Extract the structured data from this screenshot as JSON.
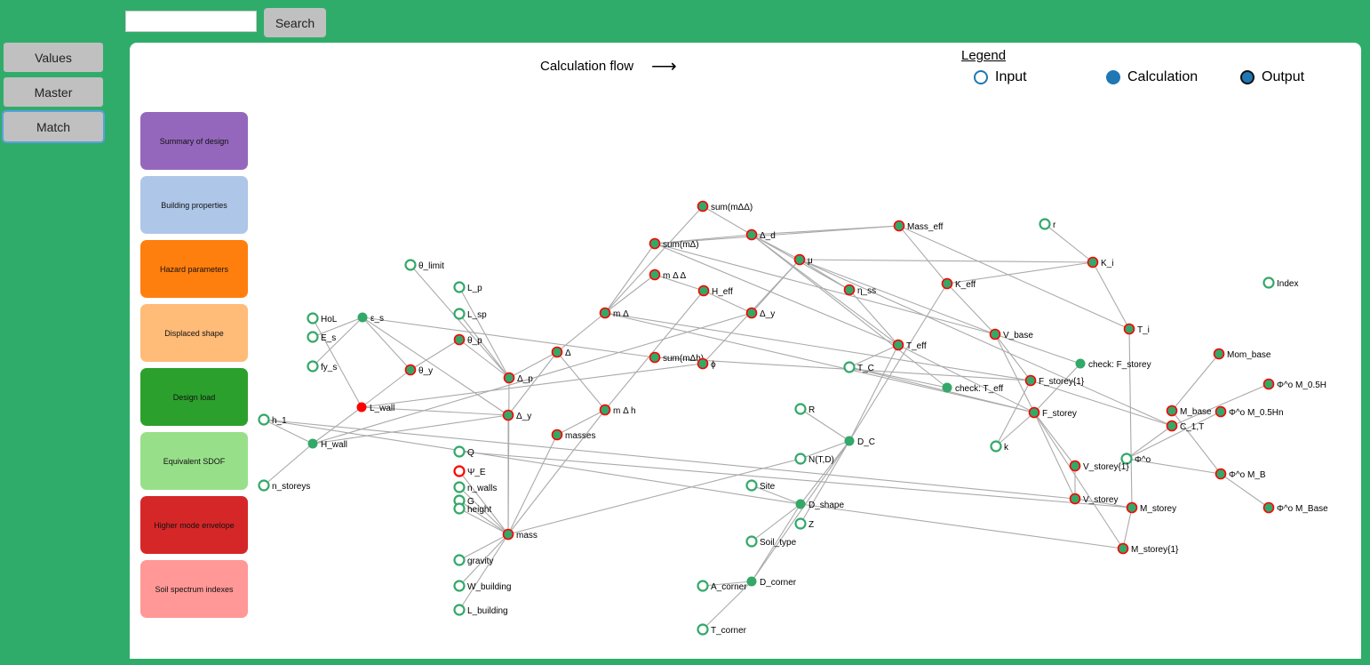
{
  "search": {
    "value": "",
    "button_label": "Search"
  },
  "sidebar": {
    "buttons": [
      {
        "label": "Values"
      },
      {
        "label": "Master"
      },
      {
        "label": "Match",
        "active": true
      }
    ]
  },
  "graph_title": "Calculation flow",
  "legend": {
    "title": "Legend",
    "items": [
      {
        "label": "Input",
        "kind": "input"
      },
      {
        "label": "Calculation",
        "kind": "calculation"
      },
      {
        "label": "Output",
        "kind": "output"
      }
    ],
    "color": "#1f77b4"
  },
  "categories": [
    {
      "label": "Summary of design",
      "color": "#9467bd"
    },
    {
      "label": "Building properties",
      "color": "#aec7e8"
    },
    {
      "label": "Hazard parameters",
      "color": "#ff7f0e"
    },
    {
      "label": "Displaced shape",
      "color": "#ffbb78"
    },
    {
      "label": "Design load",
      "color": "#2ca02c"
    },
    {
      "label": "Equivalent SDOF",
      "color": "#98df8a"
    },
    {
      "label": "Higher mode envelope",
      "color": "#d62728"
    },
    {
      "label": "Soil spectrum indexes",
      "color": "#ff9896"
    }
  ],
  "colors": {
    "background": "#30ac6a",
    "node": "#33a868",
    "highlight": "#ff0000",
    "edge": "#aaaaaa"
  },
  "nodes": [
    {
      "id": "sum_mdd",
      "label": "sum(mΔΔ)",
      "type": "output"
    },
    {
      "id": "sum_md",
      "label": "sum(mΔ)",
      "type": "output"
    },
    {
      "id": "d_d",
      "label": "Δ_d",
      "type": "output"
    },
    {
      "id": "mass_eff",
      "label": "Mass_eff",
      "type": "output"
    },
    {
      "id": "r",
      "label": "r",
      "type": "input"
    },
    {
      "id": "mu",
      "label": "μ",
      "type": "output"
    },
    {
      "id": "K_i",
      "label": "K_i",
      "type": "output"
    },
    {
      "id": "theta_limit",
      "label": "θ_limit",
      "type": "input"
    },
    {
      "id": "L_p",
      "label": "L_p",
      "type": "input"
    },
    {
      "id": "m_dd",
      "label": "m Δ Δ",
      "type": "output"
    },
    {
      "id": "H_eff",
      "label": "H_eff",
      "type": "output"
    },
    {
      "id": "eta_ss",
      "label": "η_ss",
      "type": "output"
    },
    {
      "id": "K_eff",
      "label": "K_eff",
      "type": "output"
    },
    {
      "id": "Index",
      "label": "Index",
      "type": "input"
    },
    {
      "id": "L_sp",
      "label": "L_sp",
      "type": "input"
    },
    {
      "id": "HoL",
      "label": "HoL",
      "type": "input"
    },
    {
      "id": "eps_s",
      "label": "ε_s",
      "type": "calculation"
    },
    {
      "id": "m_d",
      "label": "m Δ",
      "type": "output"
    },
    {
      "id": "d_y1",
      "label": "Δ_y",
      "type": "output"
    },
    {
      "id": "E_s",
      "label": "E_s",
      "type": "input"
    },
    {
      "id": "theta_p",
      "label": "θ_p",
      "type": "output"
    },
    {
      "id": "T_i",
      "label": "T_i",
      "type": "output"
    },
    {
      "id": "V_base",
      "label": "V_base",
      "type": "output"
    },
    {
      "id": "T_eff",
      "label": "T_eff",
      "type": "output"
    },
    {
      "id": "delta",
      "label": "Δ",
      "type": "output"
    },
    {
      "id": "Mom_base",
      "label": "Mom_base",
      "type": "output"
    },
    {
      "id": "sum_mdh",
      "label": "sum(mΔh)",
      "type": "output"
    },
    {
      "id": "phi",
      "label": "ϕ",
      "type": "output"
    },
    {
      "id": "fy_s",
      "label": "fy_s",
      "type": "input"
    },
    {
      "id": "theta_y",
      "label": "θ_y",
      "type": "output"
    },
    {
      "id": "T_C",
      "label": "T_C",
      "type": "input"
    },
    {
      "id": "check_F",
      "label": "check: F_storey",
      "type": "calculation"
    },
    {
      "id": "d_p",
      "label": "Δ_p",
      "type": "output"
    },
    {
      "id": "F_storey1",
      "label": "F_storey{1}",
      "type": "output"
    },
    {
      "id": "check_T",
      "label": "check: T_eff",
      "type": "calculation"
    },
    {
      "id": "phi_05H",
      "label": "Φ^o M_0.5H",
      "type": "output"
    },
    {
      "id": "L_wall",
      "label": "L_wall",
      "type": "selected"
    },
    {
      "id": "R",
      "label": "R",
      "type": "input"
    },
    {
      "id": "m_dh",
      "label": "m Δ h",
      "type": "output"
    },
    {
      "id": "d_y2",
      "label": "Δ_y",
      "type": "output"
    },
    {
      "id": "F_storey",
      "label": "F_storey",
      "type": "output"
    },
    {
      "id": "M_base",
      "label": "M_base",
      "type": "output"
    },
    {
      "id": "phi_05Hn",
      "label": "Φ^o M_0.5Hn",
      "type": "output"
    },
    {
      "id": "h_1",
      "label": "h_1",
      "type": "input"
    },
    {
      "id": "C_1T",
      "label": "C_1,T",
      "type": "output"
    },
    {
      "id": "masses",
      "label": "masses",
      "type": "output"
    },
    {
      "id": "H_wall",
      "label": "H_wall",
      "type": "calculation"
    },
    {
      "id": "D_C",
      "label": "D_C",
      "type": "calculation"
    },
    {
      "id": "k",
      "label": "k",
      "type": "input"
    },
    {
      "id": "Q",
      "label": "Q",
      "type": "input"
    },
    {
      "id": "N_TD",
      "label": "N(T,D)",
      "type": "input"
    },
    {
      "id": "Phi_o",
      "label": "Φ^o",
      "type": "input"
    },
    {
      "id": "V_storey1",
      "label": "V_storey{1}",
      "type": "output"
    },
    {
      "id": "Psi_E",
      "label": "Ψ_E",
      "type": "input-selected"
    },
    {
      "id": "phi_MB",
      "label": "Φ^o M_B",
      "type": "output"
    },
    {
      "id": "n_walls",
      "label": "n_walls",
      "type": "input"
    },
    {
      "id": "n_storeys",
      "label": "n_storeys",
      "type": "input"
    },
    {
      "id": "Site",
      "label": "Site",
      "type": "input"
    },
    {
      "id": "G",
      "label": "G",
      "type": "input"
    },
    {
      "id": "height",
      "label": "height",
      "type": "input"
    },
    {
      "id": "D_shape",
      "label": "D_shape",
      "type": "calculation"
    },
    {
      "id": "V_storey",
      "label": "V_storey",
      "type": "output"
    },
    {
      "id": "M_storey",
      "label": "M_storey",
      "type": "output"
    },
    {
      "id": "phi_MBase",
      "label": "Φ^o M_Base",
      "type": "output"
    },
    {
      "id": "Z",
      "label": "Z",
      "type": "input"
    },
    {
      "id": "mass",
      "label": "mass",
      "type": "output"
    },
    {
      "id": "Soil_type",
      "label": "Soil_type",
      "type": "input"
    },
    {
      "id": "M_storey1",
      "label": "M_storey{1}",
      "type": "output"
    },
    {
      "id": "gravity",
      "label": "gravity",
      "type": "input"
    },
    {
      "id": "D_corner",
      "label": "D_corner",
      "type": "calculation"
    },
    {
      "id": "A_corner",
      "label": "A_corner",
      "type": "input"
    },
    {
      "id": "W_building",
      "label": "W_building",
      "type": "input"
    },
    {
      "id": "L_building",
      "label": "L_building",
      "type": "input"
    },
    {
      "id": "T_corner",
      "label": "T_corner",
      "type": "input"
    }
  ],
  "edges": [
    [
      "HoL",
      "L_wall"
    ],
    [
      "E_s",
      "eps_s"
    ],
    [
      "fy_s",
      "eps_s"
    ],
    [
      "eps_s",
      "theta_y"
    ],
    [
      "eps_s",
      "d_y2"
    ],
    [
      "eps_s",
      "sum_mdh"
    ],
    [
      "theta_limit",
      "d_p"
    ],
    [
      "L_p",
      "d_p"
    ],
    [
      "L_sp",
      "d_p"
    ],
    [
      "theta_p",
      "d_p"
    ],
    [
      "theta_y",
      "theta_p"
    ],
    [
      "L_wall",
      "theta_y"
    ],
    [
      "H_wall",
      "L_wall"
    ],
    [
      "L_wall",
      "d_y2"
    ],
    [
      "L_wall",
      "phi"
    ],
    [
      "H_wall",
      "d_y2"
    ],
    [
      "H_wall",
      "d_y1"
    ],
    [
      "h_1",
      "H_wall"
    ],
    [
      "h_1",
      "V_storey"
    ],
    [
      "h_1",
      "D_shape"
    ],
    [
      "n_storeys",
      "H_wall"
    ],
    [
      "d_p",
      "delta"
    ],
    [
      "d_y2",
      "delta"
    ],
    [
      "delta",
      "m_d"
    ],
    [
      "delta",
      "m_dh"
    ],
    [
      "m_d",
      "m_dd"
    ],
    [
      "m_d",
      "sum_mdd"
    ],
    [
      "m_d",
      "sum_md"
    ],
    [
      "m_d",
      "F_storey1"
    ],
    [
      "m_d",
      "F_storey"
    ],
    [
      "m_dd",
      "H_eff"
    ],
    [
      "m_dd",
      "m_d"
    ],
    [
      "sum_md",
      "d_d"
    ],
    [
      "sum_md",
      "T_eff"
    ],
    [
      "sum_md",
      "V_base"
    ],
    [
      "sum_mdd",
      "d_d"
    ],
    [
      "d_d",
      "mass_eff"
    ],
    [
      "sum_md",
      "mass_eff"
    ],
    [
      "d_d",
      "mu"
    ],
    [
      "d_d",
      "eta_ss"
    ],
    [
      "d_d",
      "T_eff"
    ],
    [
      "d_d",
      "check_T"
    ],
    [
      "mu",
      "K_i"
    ],
    [
      "mu",
      "eta_ss"
    ],
    [
      "mu",
      "d_y1"
    ],
    [
      "mu",
      "V_base"
    ],
    [
      "mu",
      "phi"
    ],
    [
      "mu",
      "C_1T"
    ],
    [
      "mass_eff",
      "K_eff"
    ],
    [
      "mass_eff",
      "T_i"
    ],
    [
      "r",
      "K_i"
    ],
    [
      "K_i",
      "K_eff"
    ],
    [
      "K_i",
      "T_i"
    ],
    [
      "K_eff",
      "V_base"
    ],
    [
      "K_eff",
      "D_C"
    ],
    [
      "eta_ss",
      "T_eff"
    ],
    [
      "T_eff",
      "T_C"
    ],
    [
      "T_eff",
      "D_C"
    ],
    [
      "T_eff",
      "F_storey"
    ],
    [
      "V_base",
      "check_F"
    ],
    [
      "V_base",
      "F_storey"
    ],
    [
      "V_base",
      "F_storey1"
    ],
    [
      "check_F",
      "F_storey"
    ],
    [
      "H_eff",
      "d_y1"
    ],
    [
      "H_eff",
      "m_dh"
    ],
    [
      "T_C",
      "check_T"
    ],
    [
      "T_C",
      "F_storey"
    ],
    [
      "sum_mdh",
      "F_storey1"
    ],
    [
      "m_dh",
      "masses"
    ],
    [
      "m_dh",
      "mass"
    ],
    [
      "masses",
      "mass"
    ],
    [
      "d_p",
      "mass"
    ],
    [
      "d_y2",
      "mass"
    ],
    [
      "Q",
      "M_storey"
    ],
    [
      "Psi_E",
      "mass"
    ],
    [
      "n_walls",
      "mass"
    ],
    [
      "G",
      "mass"
    ],
    [
      "height",
      "mass"
    ],
    [
      "gravity",
      "mass"
    ],
    [
      "W_building",
      "mass"
    ],
    [
      "L_building",
      "mass"
    ],
    [
      "mass",
      "N_TD"
    ],
    [
      "N_TD",
      "D_C"
    ],
    [
      "R",
      "D_C"
    ],
    [
      "D_C",
      "D_shape"
    ],
    [
      "D_C",
      "Z"
    ],
    [
      "D_C",
      "D_corner"
    ],
    [
      "Site",
      "D_shape"
    ],
    [
      "Soil_type",
      "D_shape"
    ],
    [
      "D_shape",
      "M_storey1"
    ],
    [
      "D_corner",
      "A_corner"
    ],
    [
      "D_corner",
      "T_corner"
    ],
    [
      "D_corner",
      "D_shape"
    ],
    [
      "k",
      "F_storey1"
    ],
    [
      "k",
      "F_storey"
    ],
    [
      "F_storey",
      "V_storey1"
    ],
    [
      "F_storey",
      "V_storey"
    ],
    [
      "F_storey",
      "M_storey1"
    ],
    [
      "V_storey1",
      "V_storey"
    ],
    [
      "V_storey",
      "M_storey"
    ],
    [
      "M_storey",
      "M_storey1"
    ],
    [
      "T_i",
      "M_storey"
    ],
    [
      "Mom_base",
      "M_base"
    ],
    [
      "M_base",
      "phi_MB"
    ],
    [
      "C_1T",
      "phi_05H"
    ],
    [
      "Phi_o",
      "phi_05Hn"
    ],
    [
      "Phi_o",
      "phi_MB"
    ],
    [
      "phi_MB",
      "phi_MBase"
    ],
    [
      "Phi_o",
      "C_1T"
    ],
    [
      "F_storey1",
      "C_1T"
    ]
  ]
}
